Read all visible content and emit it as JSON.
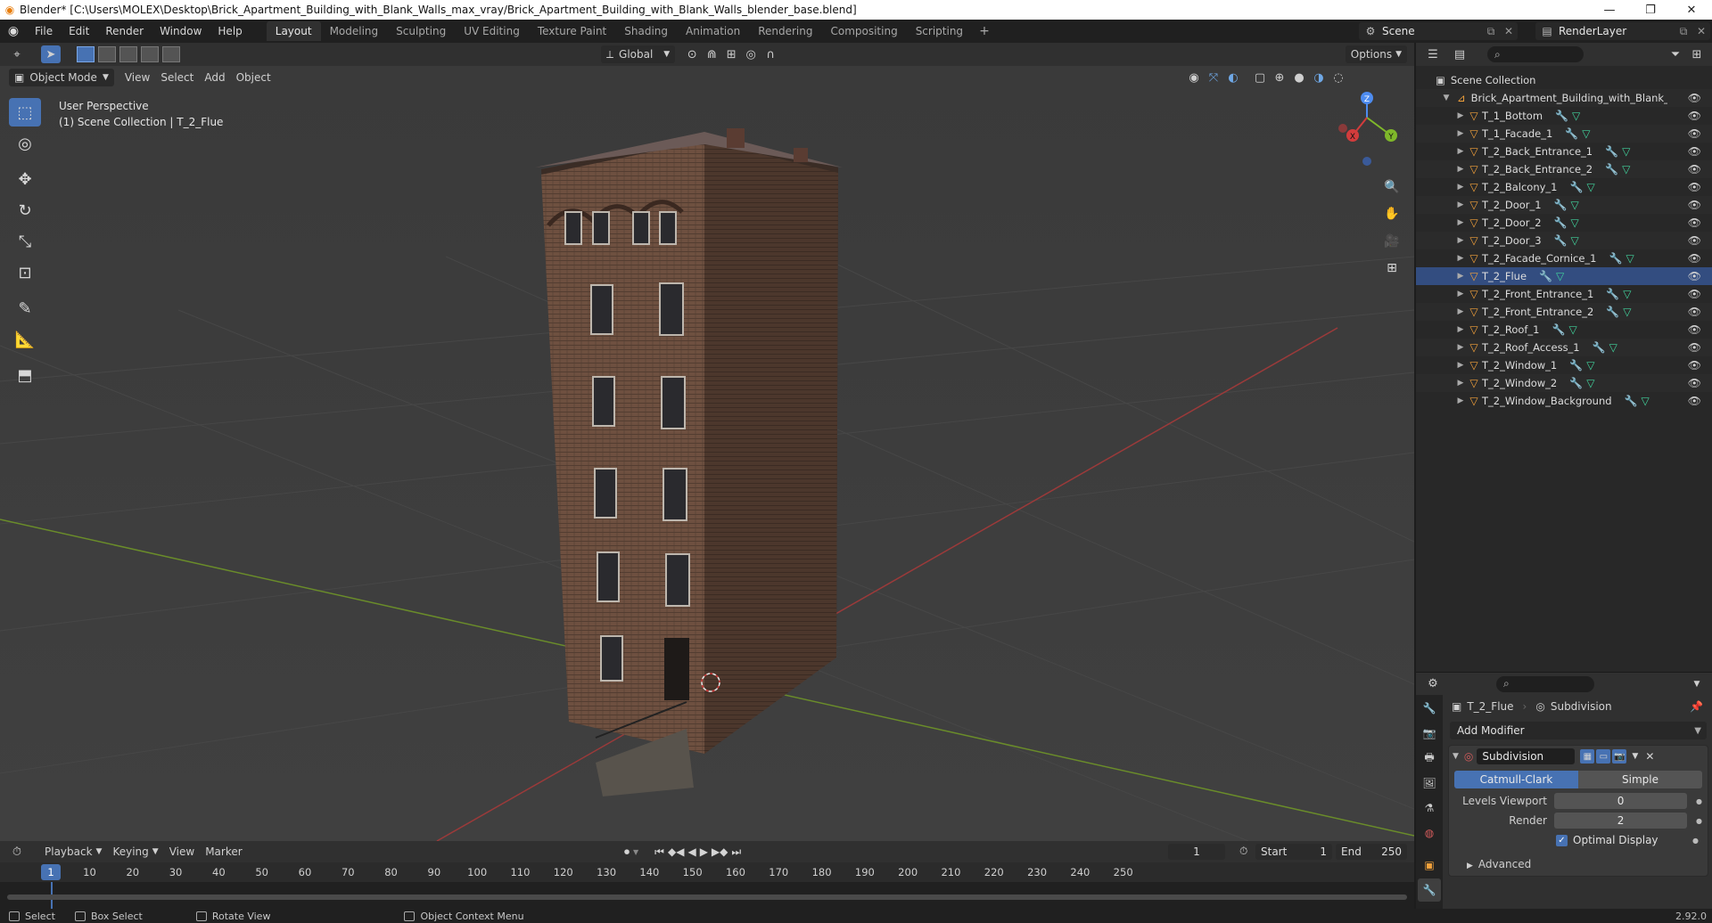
{
  "window": {
    "title": "Blender* [C:\\Users\\MOLEX\\Desktop\\Brick_Apartment_Building_with_Blank_Walls_max_vray/Brick_Apartment_Building_with_Blank_Walls_blender_base.blend]",
    "minimize": "—",
    "maximize": "❐",
    "close": "✕"
  },
  "menu": [
    "File",
    "Edit",
    "Render",
    "Window",
    "Help"
  ],
  "workspaces": [
    "Layout",
    "Modeling",
    "Sculpting",
    "UV Editing",
    "Texture Paint",
    "Shading",
    "Animation",
    "Rendering",
    "Compositing",
    "Scripting"
  ],
  "active_workspace": "Layout",
  "scene": {
    "name": "Scene",
    "view_layer": "RenderLayer"
  },
  "viewport": {
    "transform_orientation": "Global",
    "options_label": "Options",
    "mode": "Object Mode",
    "header_menus": [
      "View",
      "Select",
      "Add",
      "Object"
    ],
    "overlay_line1": "User Perspective",
    "overlay_line2": "(1) Scene Collection | T_2_Flue",
    "gizmo": {
      "x": "X",
      "y": "Y",
      "z": "Z"
    }
  },
  "outliner": {
    "root": "Scene Collection",
    "collection": "Brick_Apartment_Building_with_Blank_Walls",
    "selected": "T_2_Flue",
    "objects": [
      "T_1_Bottom",
      "T_1_Facade_1",
      "T_2_Back_Entrance_1",
      "T_2_Back_Entrance_2",
      "T_2_Balcony_1",
      "T_2_Door_1",
      "T_2_Door_2",
      "T_2_Door_3",
      "T_2_Facade_Cornice_1",
      "T_2_Flue",
      "T_2_Front_Entrance_1",
      "T_2_Front_Entrance_2",
      "T_2_Roof_1",
      "T_2_Roof_Access_1",
      "T_2_Window_1",
      "T_2_Window_2",
      "T_2_Window_Background"
    ]
  },
  "properties": {
    "object": "T_2_Flue",
    "modifier_context": "Subdivision",
    "add_modifier": "Add Modifier",
    "modifier_name": "Subdivision",
    "algo_options": [
      "Catmull-Clark",
      "Simple"
    ],
    "algo_selected": "Catmull-Clark",
    "levels_viewport_label": "Levels Viewport",
    "levels_viewport": "0",
    "render_label": "Render",
    "render": "2",
    "optimal_display_label": "Optimal Display",
    "optimal_display": true,
    "advanced_label": "Advanced"
  },
  "timeline": {
    "menus": [
      "Playback",
      "Keying",
      "View",
      "Marker"
    ],
    "current_frame": "1",
    "start_label": "Start",
    "start": "1",
    "end_label": "End",
    "end": "250",
    "ticks": [
      "10",
      "20",
      "30",
      "40",
      "50",
      "60",
      "70",
      "80",
      "90",
      "100",
      "110",
      "120",
      "130",
      "140",
      "150",
      "160",
      "170",
      "180",
      "190",
      "200",
      "210",
      "220",
      "230",
      "240",
      "250"
    ]
  },
  "statusbar": {
    "select": "Select",
    "box_select": "Box Select",
    "rotate_view": "Rotate View",
    "context_menu": "Object Context Menu",
    "version": "2.92.0"
  },
  "colors": {
    "accent": "#4772b3",
    "axis_x": "#d23c3c",
    "axis_y": "#7fb82a",
    "object_icon": "#f2a13b",
    "mesh_icon": "#41d29c",
    "modifier_icon": "#6fa8e6"
  }
}
